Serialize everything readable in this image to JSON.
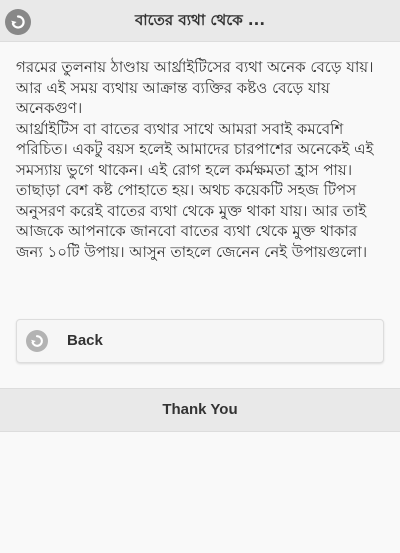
{
  "header": {
    "title": "বাতের ব্যথা থেকে ...",
    "back_icon": "back-arrow-icon"
  },
  "article": {
    "paragraphs": [
      "গরমের তুলনায় ঠাণ্ডায় আর্থ্রাইটিসের ব্যথা অনেক বেড়ে যায়। আর এই সময় ব্যথায় আক্রান্ত ব্যক্তির কষ্টও বেড়ে যায় অনেকগুণ।",
      "আর্থ্রাইটিস বা বাতের ব্যথার সাথে আমরা সবাই কমবেশি পরিচিত। একটু বয়স হলেই আমাদের চারপাশের অনেকেই এই সমস্যায় ভুগে থাকেন। এই রোগ হলে কর্মক্ষমতা হ্রাস পায়। তাছাড়া বেশ কষ্ট পোহাতে হয়। অথচ কয়েকটি সহজ টিপস অনুসরণ করেই বাতের ব্যথা থেকে মুক্ত থাকা যায়। আর তাই আজকে আপনাকে জানবো বাতের ব্যথা থেকে মুক্ত থাকার জন্য ১০টি উপায়। আসুন তাহলে জেনেন নেই উপায়গুলো।"
    ]
  },
  "back_button": {
    "label": "Back",
    "icon": "back-arrow-icon"
  },
  "footer": {
    "title": "Thank You"
  },
  "colors": {
    "header_bg": "#e9e9e9",
    "page_bg": "#f9f9f9",
    "icon_circle": "#888888",
    "button_icon_circle": "#b3b3b3",
    "text": "#333333"
  }
}
